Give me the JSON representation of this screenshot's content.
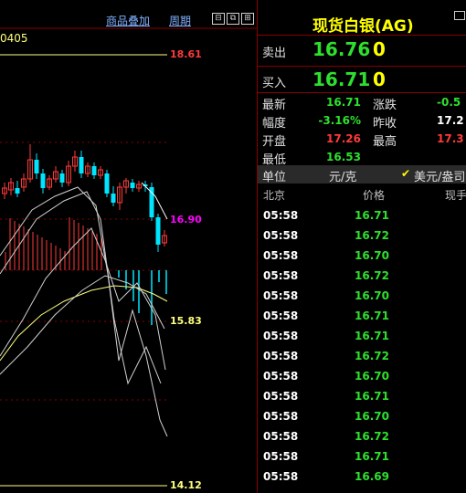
{
  "chart": {
    "code": "0405",
    "menu_overlay": "商品叠加",
    "menu_period": "周期",
    "price_labels": {
      "top": "18.61",
      "current": "16.90",
      "mid": "15.83",
      "bottom": "14.12"
    },
    "colors": {
      "up": "#ff3a3a",
      "down": "#00e5ff",
      "grid": "#8a0000",
      "ma": "#ffff80"
    }
  },
  "panel": {
    "title": "现货白银(AG)",
    "sell_label": "卖出",
    "sell_price": "16.76",
    "sell_vol": "0",
    "buy_label": "买入",
    "buy_price": "16.71",
    "buy_vol": "0",
    "quote": [
      {
        "l1": "最新",
        "v1": "16.71",
        "c1": "green",
        "l2": "涨跌",
        "v2": "-0.5",
        "c2": "green"
      },
      {
        "l1": "幅度",
        "v1": "-3.16%",
        "c1": "green",
        "l2": "昨收",
        "v2": "17.2",
        "c2": "white"
      },
      {
        "l1": "开盘",
        "v1": "17.26",
        "c1": "red",
        "l2": "最高",
        "v2": "17.3",
        "c2": "red"
      },
      {
        "l1": "最低",
        "v1": "16.53",
        "c1": "green",
        "l2": "",
        "v2": "",
        "c2": "white"
      }
    ],
    "unit_label": "单位",
    "unit_value": "元/克",
    "unit_alt": "美元/盎司",
    "tick_headers": {
      "city": "北京",
      "price": "价格",
      "volume": "现手"
    },
    "ticks": [
      {
        "time": "05:58",
        "price": "16.71"
      },
      {
        "time": "05:58",
        "price": "16.72"
      },
      {
        "time": "05:58",
        "price": "16.70"
      },
      {
        "time": "05:58",
        "price": "16.72"
      },
      {
        "time": "05:58",
        "price": "16.70"
      },
      {
        "time": "05:58",
        "price": "16.71"
      },
      {
        "time": "05:58",
        "price": "16.71"
      },
      {
        "time": "05:58",
        "price": "16.72"
      },
      {
        "time": "05:58",
        "price": "16.70"
      },
      {
        "time": "05:58",
        "price": "16.71"
      },
      {
        "time": "05:58",
        "price": "16.70"
      },
      {
        "time": "05:58",
        "price": "16.72"
      },
      {
        "time": "05:58",
        "price": "16.71"
      },
      {
        "time": "05:58",
        "price": "16.69"
      }
    ]
  }
}
